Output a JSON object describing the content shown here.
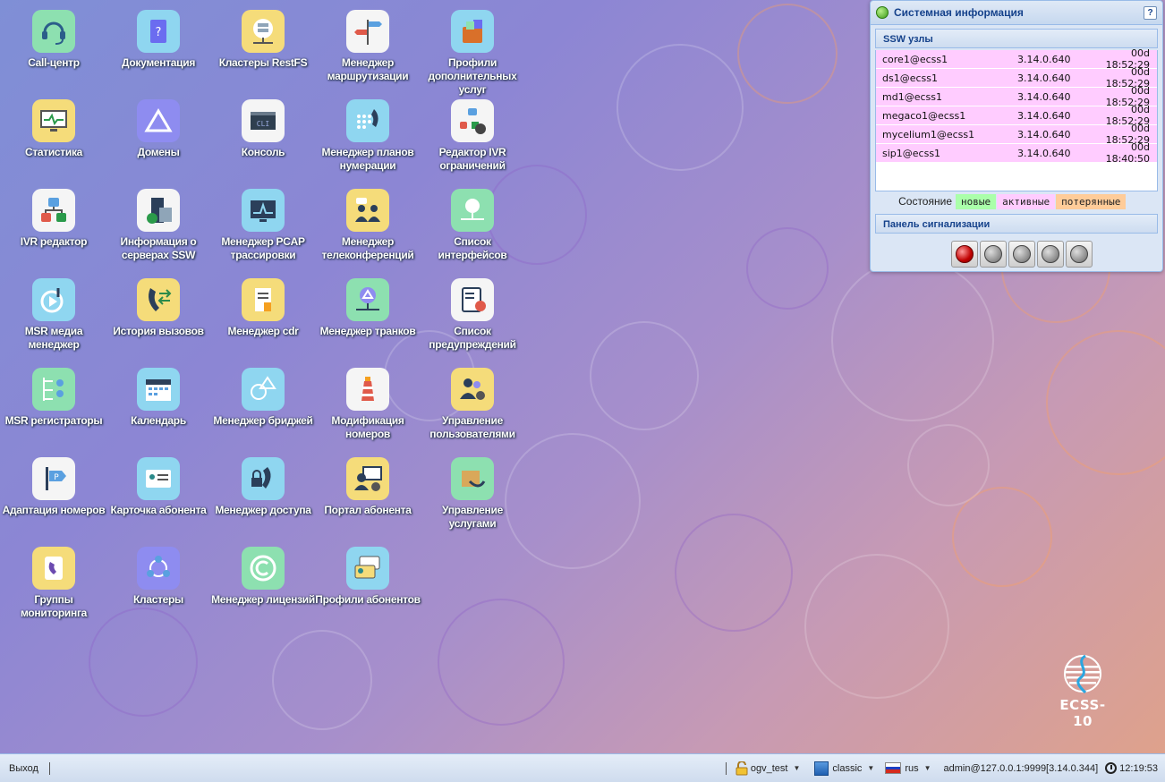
{
  "apps": [
    {
      "label": "Call-центр",
      "icon": "call-center-icon",
      "bg": "#8de0b0"
    },
    {
      "label": "Документация",
      "icon": "documentation-icon",
      "bg": "#8fd6f0"
    },
    {
      "label": "Кластеры RestFS",
      "icon": "restfs-cluster-icon",
      "bg": "#f5dc7a"
    },
    {
      "label": "Менеджер маршрутизации",
      "icon": "routing-signpost-icon",
      "bg": "#f5f5f5"
    },
    {
      "label": "Профили дополнительных услуг",
      "icon": "service-profiles-icon",
      "bg": "#8fd6f0"
    },
    {
      "label": "Статистика",
      "icon": "statistics-monitor-icon",
      "bg": "#f5dc7a"
    },
    {
      "label": "Домены",
      "icon": "domains-triangle-icon",
      "bg": "#8e8cf0"
    },
    {
      "label": "Консоль",
      "icon": "console-cli-icon",
      "bg": "#f5f5f5"
    },
    {
      "label": "Менеджер планов нумерации",
      "icon": "dialplan-phone-icon",
      "bg": "#8fd6f0"
    },
    {
      "label": "Редактор IVR ограничений",
      "icon": "ivr-restrictions-icon",
      "bg": "#f5f5f5"
    },
    {
      "label": "IVR редактор",
      "icon": "ivr-editor-icon",
      "bg": "#f5f5f5"
    },
    {
      "label": "Информация о серверах SSW",
      "icon": "server-info-icon",
      "bg": "#f5f5f5"
    },
    {
      "label": "Менеджер PCAP трассировки",
      "icon": "pcap-trace-icon",
      "bg": "#8fd6f0"
    },
    {
      "label": "Менеджер телеконференций",
      "icon": "teleconference-icon",
      "bg": "#f5dc7a"
    },
    {
      "label": "Список интерфейсов",
      "icon": "interfaces-list-icon",
      "bg": "#8de0b0"
    },
    {
      "label": "MSR медиа менеджер",
      "icon": "msr-media-icon",
      "bg": "#8fd6f0"
    },
    {
      "label": "История вызовов",
      "icon": "call-history-icon",
      "bg": "#f5dc7a"
    },
    {
      "label": "Менеджер cdr",
      "icon": "cdr-document-icon",
      "bg": "#f5dc7a"
    },
    {
      "label": "Менеджер транков",
      "icon": "trunk-manager-icon",
      "bg": "#8de0b0"
    },
    {
      "label": "Список предупреждений",
      "icon": "alarms-list-icon",
      "bg": "#f5f5f5"
    },
    {
      "label": "MSR регистраторы",
      "icon": "msr-registrars-icon",
      "bg": "#8de0b0"
    },
    {
      "label": "Календарь",
      "icon": "calendar-icon",
      "bg": "#8fd6f0"
    },
    {
      "label": "Менеджер бриджей",
      "icon": "bridges-icon",
      "bg": "#8fd6f0"
    },
    {
      "label": "Модификация номеров",
      "icon": "lighthouse-icon",
      "bg": "#f5f5f5"
    },
    {
      "label": "Управление пользователями",
      "icon": "users-management-icon",
      "bg": "#f5dc7a"
    },
    {
      "label": "Адаптация номеров",
      "icon": "number-adaptation-icon",
      "bg": "#f5f5f5"
    },
    {
      "label": "Карточка абонента",
      "icon": "subscriber-card-icon",
      "bg": "#8fd6f0"
    },
    {
      "label": "Менеджер доступа",
      "icon": "access-phone-lock-icon",
      "bg": "#8fd6f0"
    },
    {
      "label": "Портал абонента",
      "icon": "subscriber-portal-icon",
      "bg": "#f5dc7a"
    },
    {
      "label": "Управление услугами",
      "icon": "services-management-icon",
      "bg": "#8de0b0"
    },
    {
      "label": "Группы мониторинга",
      "icon": "monitoring-groups-icon",
      "bg": "#f5dc7a"
    },
    {
      "label": "Кластеры",
      "icon": "clusters-icon",
      "bg": "#8e8cf0"
    },
    {
      "label": "Менеджер лицензий",
      "icon": "license-copyright-icon",
      "bg": "#8de0b0"
    },
    {
      "label": "Профили абонентов",
      "icon": "subscriber-profiles-icon",
      "bg": "#8fd6f0"
    }
  ],
  "sysinfo": {
    "title": "Системная информация",
    "help": "?",
    "nodes_title": "SSW узлы",
    "nodes": [
      {
        "name": "core1@ecss1",
        "version": "3.14.0.640",
        "uptime": "00d 18:52:29"
      },
      {
        "name": "ds1@ecss1",
        "version": "3.14.0.640",
        "uptime": "00d 18:52:29"
      },
      {
        "name": "md1@ecss1",
        "version": "3.14.0.640",
        "uptime": "00d 18:52:29"
      },
      {
        "name": "megaco1@ecss1",
        "version": "3.14.0.640",
        "uptime": "00d 18:52:29"
      },
      {
        "name": "mycelium1@ecss1",
        "version": "3.14.0.640",
        "uptime": "00d 18:52:29"
      },
      {
        "name": "sip1@ecss1",
        "version": "3.14.0.640",
        "uptime": "00d 18:40:50"
      }
    ],
    "legend": {
      "label": "Состояние",
      "new": "новые",
      "active": "активные",
      "lost": "потерянные"
    },
    "alarm_title": "Панель сигнализации",
    "alarm_lamps": [
      "red",
      "grey",
      "grey",
      "grey",
      "grey"
    ]
  },
  "logo": {
    "text": "ECSS-10"
  },
  "taskbar": {
    "exit": "Выход",
    "user": "ogv_test",
    "theme": "classic",
    "lang": "rus",
    "session": "admin@127.0.0.1:9999[3.14.0.344]",
    "time": "12:19:53"
  }
}
